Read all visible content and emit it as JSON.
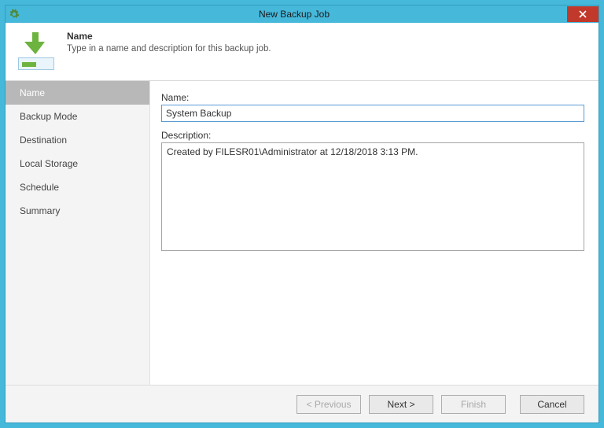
{
  "titlebar": {
    "title": "New Backup Job"
  },
  "header": {
    "title": "Name",
    "subtitle": "Type in a name and description for this backup job."
  },
  "sidebar": {
    "items": [
      "Name",
      "Backup Mode",
      "Destination",
      "Local Storage",
      "Schedule",
      "Summary"
    ],
    "activeIndex": 0
  },
  "form": {
    "name_label": "Name:",
    "name_value": "System Backup",
    "description_label": "Description:",
    "description_value": "Created by FILESR01\\Administrator at 12/18/2018 3:13 PM."
  },
  "buttons": {
    "previous": "< Previous",
    "next": "Next >",
    "finish": "Finish",
    "cancel": "Cancel"
  },
  "colors": {
    "accent": "#46b8da",
    "green": "#6db33f"
  }
}
